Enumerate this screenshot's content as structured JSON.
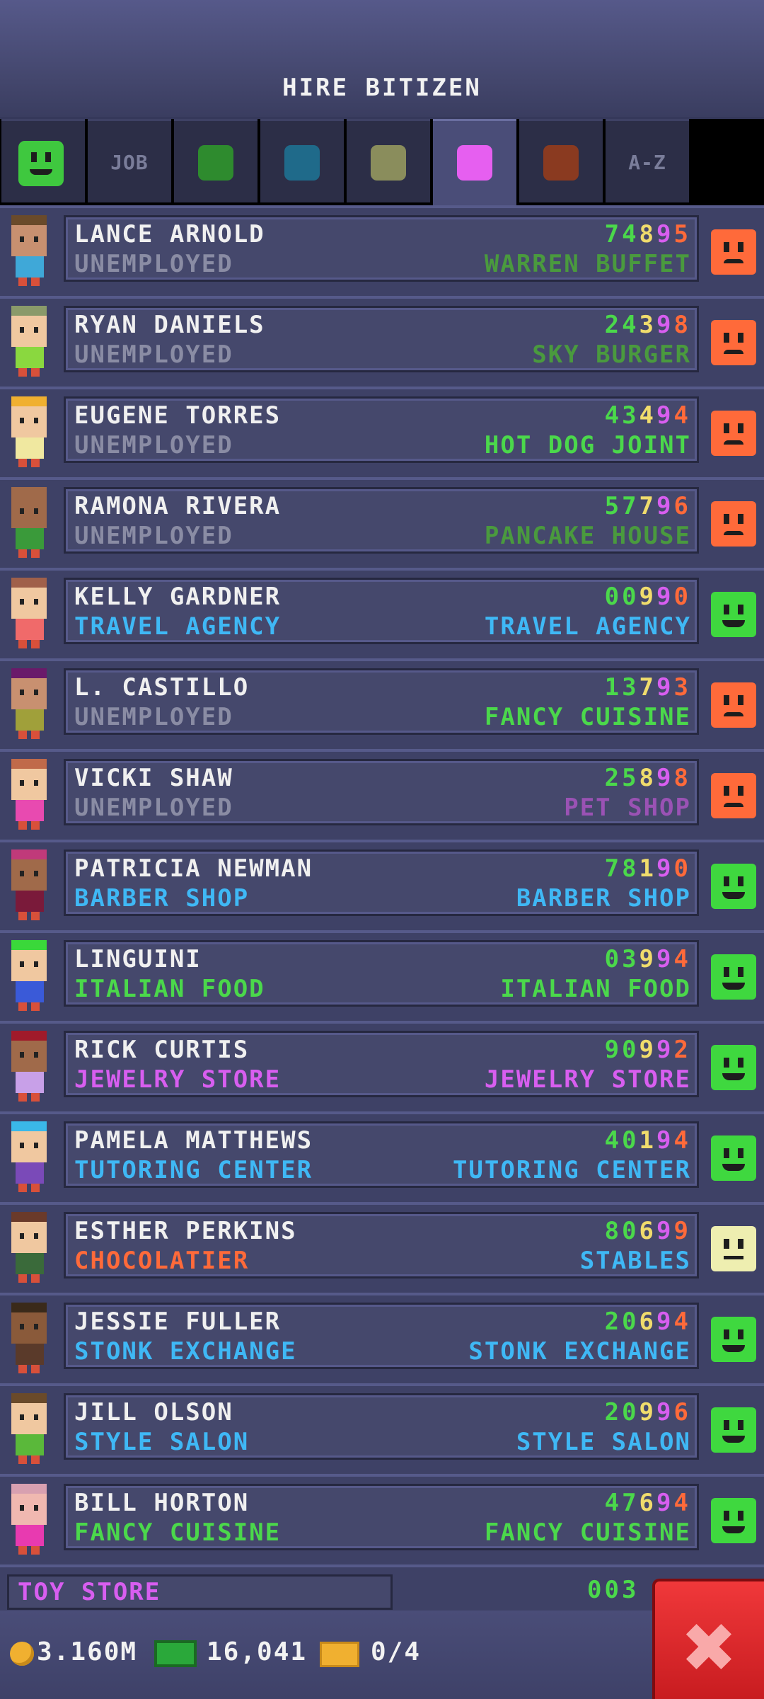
{
  "header": {
    "title": "HIRE BITIZEN"
  },
  "tabs": [
    {
      "type": "face",
      "color": "#3fc83f"
    },
    {
      "type": "text",
      "label": "JOB"
    },
    {
      "type": "swatch",
      "color": "#2e8b2e"
    },
    {
      "type": "swatch",
      "color": "#1f6a8a"
    },
    {
      "type": "swatch",
      "color": "#8a8d5c"
    },
    {
      "type": "swatch",
      "color": "#e65ff0",
      "active": true
    },
    {
      "type": "swatch",
      "color": "#8a3a20"
    },
    {
      "type": "text",
      "label": "A-Z"
    }
  ],
  "colors": {
    "green": "#4bd84b",
    "dark_green": "#4a9a3e",
    "gray": "#8a8ca4",
    "cyan": "#3fb8f5",
    "magenta": "#d85ef0",
    "orange": "#ff6a3a",
    "purple": "#9a52b4",
    "yellow": "#f0dc6c",
    "face_angry": "#ff6a3a",
    "face_happy": "#3fd83f",
    "face_neutral": "#eeeeb0"
  },
  "rows": [
    {
      "name": "LANCE ARNOLD",
      "job": "UNEMPLOYED",
      "job_color": "gray",
      "digits": "74895",
      "dream": "WARREN BUFFET",
      "dream_color": "dark_green",
      "mood": "angry",
      "skin": "#c89070",
      "hair": "#6a4a2a",
      "shirt": "#3fa8d8"
    },
    {
      "name": "RYAN DANIELS",
      "job": "UNEMPLOYED",
      "job_color": "gray",
      "digits": "24398",
      "dream": "SKY BURGER",
      "dream_color": "dark_green",
      "mood": "angry",
      "skin": "#f0c8a0",
      "hair": "#8a9a6a",
      "shirt": "#8ad83f"
    },
    {
      "name": "EUGENE TORRES",
      "job": "UNEMPLOYED",
      "job_color": "gray",
      "digits": "43494",
      "dream": "HOT DOG JOINT",
      "dream_color": "green",
      "mood": "angry",
      "skin": "#f0c8a0",
      "hair": "#f0b030",
      "shirt": "#f0e8a0"
    },
    {
      "name": "RAMONA RIVERA",
      "job": "UNEMPLOYED",
      "job_color": "gray",
      "digits": "57796",
      "dream": "PANCAKE HOUSE",
      "dream_color": "dark_green",
      "mood": "angry",
      "skin": "#a06a4a",
      "hair": "#a06a4a",
      "shirt": "#3a9a3a"
    },
    {
      "name": "KELLY GARDNER",
      "job": "TRAVEL AGENCY",
      "job_color": "cyan",
      "digits": "00990",
      "dream": "TRAVEL AGENCY",
      "dream_color": "cyan",
      "mood": "happy",
      "skin": "#f0c8a0",
      "hair": "#a0604a",
      "shirt": "#f06a6a"
    },
    {
      "name": "L. CASTILLO",
      "job": "UNEMPLOYED",
      "job_color": "gray",
      "digits": "13793",
      "dream": "FANCY CUISINE",
      "dream_color": "green",
      "mood": "angry",
      "skin": "#c89070",
      "hair": "#6a1a6a",
      "shirt": "#a0a03a"
    },
    {
      "name": "VICKI SHAW",
      "job": "UNEMPLOYED",
      "job_color": "gray",
      "digits": "25898",
      "dream": "PET SHOP",
      "dream_color": "purple",
      "mood": "angry",
      "skin": "#f0c8a0",
      "hair": "#c06a4a",
      "shirt": "#e84ab0"
    },
    {
      "name": "PATRICIA NEWMAN",
      "job": "BARBER SHOP",
      "job_color": "cyan",
      "digits": "78190",
      "dream": "BARBER SHOP",
      "dream_color": "cyan",
      "mood": "happy",
      "skin": "#a06a4a",
      "hair": "#c03a7a",
      "shirt": "#7a1a3a"
    },
    {
      "name": "LINGUINI",
      "job": "ITALIAN FOOD",
      "job_color": "green",
      "digits": "03994",
      "dream": "ITALIAN FOOD",
      "dream_color": "green",
      "mood": "happy",
      "skin": "#f0c8a0",
      "hair": "#3ad83a",
      "shirt": "#3a5ad8"
    },
    {
      "name": "RICK CURTIS",
      "job": "JEWELRY STORE",
      "job_color": "magenta",
      "digits": "90992",
      "dream": "JEWELRY STORE",
      "dream_color": "magenta",
      "mood": "happy",
      "skin": "#a06a4a",
      "hair": "#a01a2a",
      "shirt": "#c8a0e8"
    },
    {
      "name": "PAMELA MATTHEWS",
      "job": "TUTORING CENTER",
      "job_color": "cyan",
      "digits": "40194",
      "dream": "TUTORING CENTER",
      "dream_color": "cyan",
      "mood": "happy",
      "skin": "#f0c8a0",
      "hair": "#3ab8e8",
      "shirt": "#7a4ab8"
    },
    {
      "name": "ESTHER PERKINS",
      "job": "CHOCOLATIER",
      "job_color": "orange",
      "digits": "80699",
      "dream": "STABLES",
      "dream_color": "cyan",
      "mood": "neutral",
      "skin": "#f0c8a0",
      "hair": "#6a3a2a",
      "shirt": "#3a6a3a"
    },
    {
      "name": "JESSIE FULLER",
      "job": "STONK EXCHANGE",
      "job_color": "cyan",
      "digits": "20694",
      "dream": "STONK EXCHANGE",
      "dream_color": "cyan",
      "mood": "happy",
      "skin": "#8a5a3a",
      "hair": "#3a2a1a",
      "shirt": "#5a3a2a"
    },
    {
      "name": "JILL OLSON",
      "job": "STYLE SALON",
      "job_color": "cyan",
      "digits": "20996",
      "dream": "STYLE SALON",
      "dream_color": "cyan",
      "mood": "happy",
      "skin": "#f0c8a0",
      "hair": "#6a4a2a",
      "shirt": "#5ab83a"
    },
    {
      "name": "BILL HORTON",
      "job": "FANCY CUISINE",
      "job_color": "green",
      "digits": "47694",
      "dream": "FANCY CUISINE",
      "dream_color": "green",
      "mood": "happy",
      "skin": "#f0b8b0",
      "hair": "#d8a0b0",
      "shirt": "#e83ab0"
    }
  ],
  "partial_row": {
    "label": "TOY STORE",
    "digits": "003"
  },
  "footer": {
    "coins": "3.160M",
    "cash": "16,041",
    "tickets": "0/4"
  }
}
